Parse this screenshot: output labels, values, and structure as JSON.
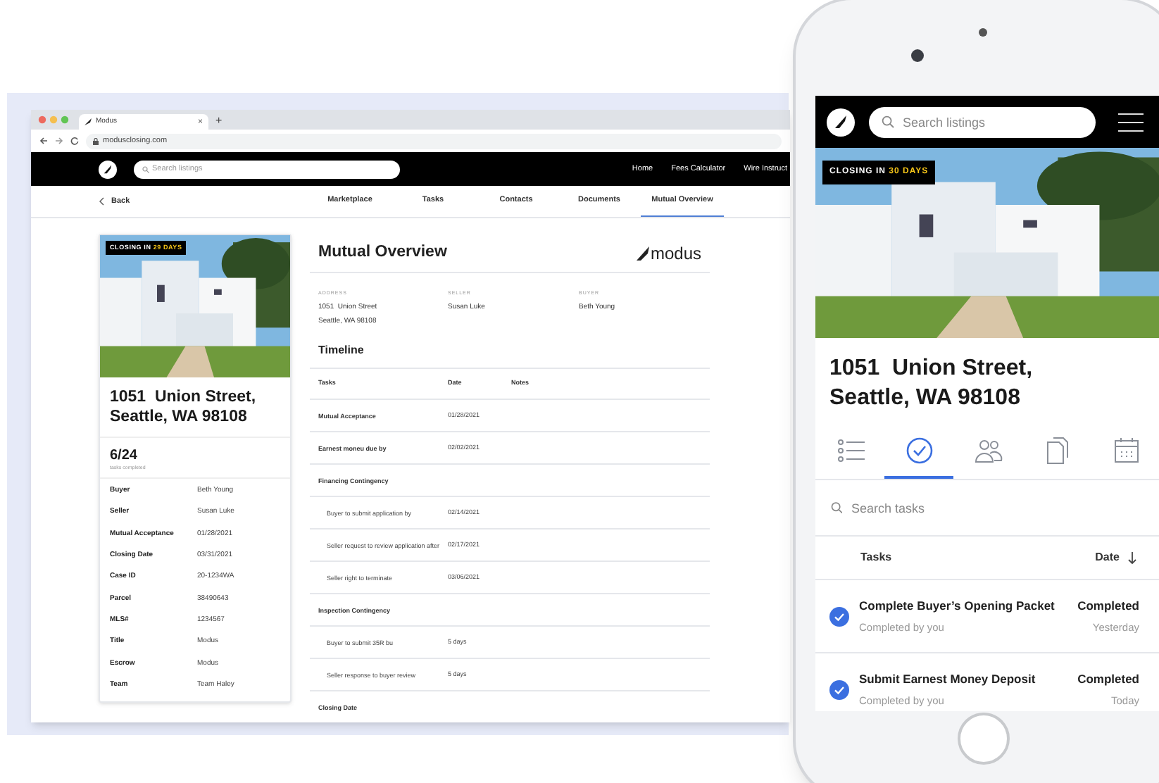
{
  "browser": {
    "tab_title": "Modus",
    "tab_close": "×",
    "new_tab": "+",
    "url": "modusclosing.com",
    "search": {
      "placeholder": "Search listings"
    },
    "nav_links": [
      "Home",
      "Fees Calculator",
      "Wire Instruct"
    ],
    "back": "Back",
    "tabs": [
      {
        "label": "Marketplace",
        "selected": false
      },
      {
        "label": "Tasks",
        "selected": false
      },
      {
        "label": "Contacts",
        "selected": false
      },
      {
        "label": "Documents",
        "selected": false
      },
      {
        "label": "Mutual Overview",
        "selected": true
      }
    ],
    "listing": {
      "badge": "CLOSING IN",
      "badge_days": "29 DAYS",
      "address": [
        "1051  Union Street,",
        "Seattle, WA 98108"
      ],
      "progress": "6/24",
      "progress_caption": "tasks completed",
      "details": [
        {
          "label": "Buyer",
          "value": "Beth Young"
        },
        {
          "label": "Seller",
          "value": "Susan Luke"
        },
        {
          "label": "Mutual Acceptance",
          "value": "01/28/2021"
        },
        {
          "label": "Closing Date",
          "value": "03/31/2021"
        },
        {
          "label": "Case ID",
          "value": "20-1234WA"
        },
        {
          "label": "Parcel",
          "value": "38490643"
        },
        {
          "label": "MLS#",
          "value": "1234567"
        },
        {
          "label": "Title",
          "value": "Modus"
        },
        {
          "label": "Escrow",
          "value": "Modus"
        },
        {
          "label": "Team",
          "value": "Team Haley"
        }
      ]
    },
    "overview": {
      "title": "Mutual Overview",
      "logo_text": "modus",
      "parties": [
        {
          "label": "ADDRESS",
          "lines": [
            "1051  Union Street",
            "Seattle, WA 98108"
          ]
        },
        {
          "label": "SELLER",
          "lines": [
            "Susan Luke"
          ]
        },
        {
          "label": "BUYER",
          "lines": [
            "Beth Young"
          ]
        }
      ],
      "timeline_title": "Timeline",
      "columns": [
        "Tasks",
        "Date",
        "Notes"
      ],
      "rows": [
        {
          "task": "Mutual Acceptance",
          "date": "01/28/2021"
        },
        {
          "task": "Earnest moneu due by",
          "date": "02/02/2021"
        },
        {
          "task": "Financing Contingency",
          "children": [
            {
              "task": "Buyer to submit application by",
              "date": "02/14/2021"
            },
            {
              "task": "Seller request to review application after",
              "date": "02/17/2021"
            },
            {
              "task": "Seller right to terminate",
              "date": "03/06/2021"
            }
          ]
        },
        {
          "task": "Inspection Contingency",
          "children": [
            {
              "task": "Buyer to submit 35R bu",
              "date": "5 days"
            },
            {
              "task": "Seller response to buyer review",
              "date": "5 days"
            }
          ]
        },
        {
          "task": "Closing Date"
        }
      ]
    }
  },
  "phone": {
    "search": {
      "placeholder": "Search listings"
    },
    "badge": "CLOSING IN",
    "badge_days": "30 DAYS",
    "address": [
      "1051  Union Street,",
      "Seattle, WA 98108"
    ],
    "tabs": [
      {
        "kind": "list",
        "selected": false
      },
      {
        "kind": "check",
        "selected": true
      },
      {
        "kind": "people",
        "selected": false
      },
      {
        "kind": "documents",
        "selected": false
      },
      {
        "kind": "calendar",
        "selected": false
      }
    ],
    "task_search": {
      "placeholder": "Search tasks"
    },
    "columns": {
      "tasks": "Tasks",
      "date": "Date"
    },
    "tasks": [
      {
        "title": "Complete Buyer’s Opening Packet",
        "subtitle": "Completed by you",
        "status": "Completed",
        "date": "Yesterday",
        "checked": true
      },
      {
        "title": "Submit Earnest Money Deposit",
        "subtitle": "Completed by you",
        "status": "Completed",
        "date": "Today",
        "checked": true
      }
    ]
  }
}
